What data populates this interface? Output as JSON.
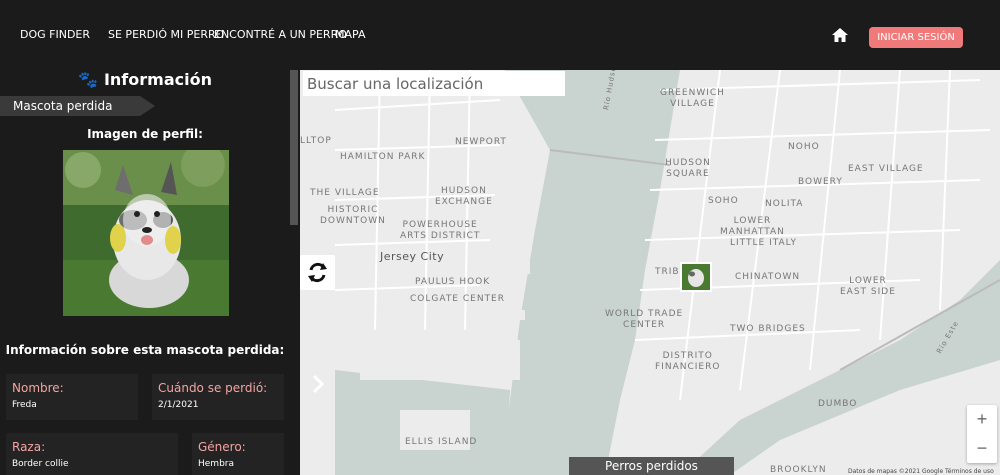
{
  "nav": {
    "brand": "DOG FINDER",
    "lost": "SE PERDIÓ MI PERRO",
    "found": "ENCONTRÉ A UN PERRO",
    "map": "MAPA",
    "login": "INICIAR SESIÓN"
  },
  "panel": {
    "title": "Información",
    "tag": "Mascota perdida",
    "profile_label": "Imagen de perfil:",
    "details_heading": "Información sobre esta mascota perdida:",
    "fields": {
      "name_label": "Nombre:",
      "name_value": "Freda",
      "date_label": "Cuándo se perdió:",
      "date_value": "2/1/2021",
      "breed_label": "Raza:",
      "breed_value": "Border collie",
      "gender_label": "Género:",
      "gender_value": "Hembra"
    }
  },
  "map": {
    "search_placeholder": "Buscar una localización",
    "labels": {
      "hamilton": "HAMILTON PARK",
      "newport": "NEWPORT",
      "village": "THE VILLAGE",
      "historic": "HISTORIC\nDOWNTOWN",
      "hudson_exchange": "HUDSON\nEXCHANGE",
      "powerhouse": "POWERHOUSE\nARTS DISTRICT",
      "jersey_city": "Jersey City",
      "paulus": "PAULUS HOOK",
      "colgate": "COLGATE CENTER",
      "ellis": "ELLIS ISLAND",
      "greenwich": "GREENWICH\nVILLAGE",
      "noho": "NOHO",
      "hudson_square": "HUDSON\nSQUARE",
      "east_village": "EAST VILLAGE",
      "bowery": "BOWERY",
      "soho": "SOHO",
      "nolita": "NOLITA",
      "lower_manhattan": "LOWER\nMANHATTAN",
      "little_italy": "LITTLE ITALY",
      "tribeca": "TRIBE",
      "chinatown": "CHINATOWN",
      "les": "LOWER\nEAST SIDE",
      "wtc": "WORLD TRADE\nCENTER",
      "two_bridges": "TWO BRIDGES",
      "fidi": "DISTRITO\nFINANCIERO",
      "dumbo": "DUMBO",
      "hoboken_edge": "LLTOP",
      "brooklyn_edge": "BROOKLYN",
      "rio_hudson": "Río Hudson",
      "rio_este": "Río Este"
    },
    "zoom_in": "+",
    "zoom_out": "−",
    "lost_tab": "Perros perdidos",
    "attribution": "Datos de mapas ©2021 Google    Términos de uso"
  },
  "icons": {
    "home": "home-icon",
    "paw": "paw-icon",
    "refresh": "refresh-icon",
    "chevron": "chevron-right-icon"
  },
  "colors": {
    "accent": "#f07a7a",
    "label_pink": "#f5a3a3",
    "background": "#1b1b1b",
    "water": "#c9d3d0"
  }
}
